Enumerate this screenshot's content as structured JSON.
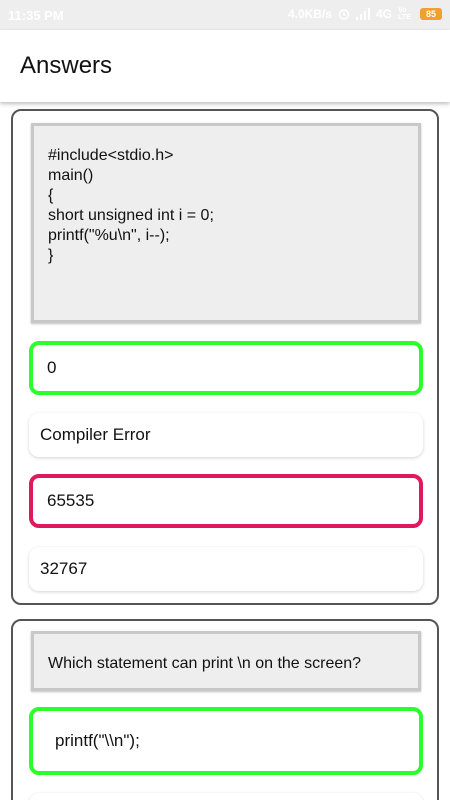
{
  "status_bar": {
    "time": "11:35 PM",
    "speed": "4.0KB/s",
    "network": "4G",
    "volte": "Vo LTE",
    "battery": "85"
  },
  "app_bar": {
    "title": "Answers"
  },
  "questions": [
    {
      "code_lines": [
        "#include<stdio.h>",
        "main()",
        "{",
        "short unsigned int i = 0;",
        "printf(\"%u\\n\", i--);",
        "}"
      ],
      "options": [
        {
          "label": "0",
          "state": "correct"
        },
        {
          "label": "Compiler Error",
          "state": "neutral"
        },
        {
          "label": "65535",
          "state": "wrong"
        },
        {
          "label": "32767",
          "state": "neutral"
        }
      ]
    },
    {
      "text": "Which statement can print \\n on the screen?",
      "options": [
        {
          "label": "printf(\"\\\\n\");",
          "state": "correct"
        },
        {
          "label": "",
          "state": "neutral"
        }
      ]
    }
  ],
  "colors": {
    "correct": "#2cfe2c",
    "wrong": "#e0195e",
    "question_bg": "#eeeeee",
    "card_border": "#555555"
  }
}
